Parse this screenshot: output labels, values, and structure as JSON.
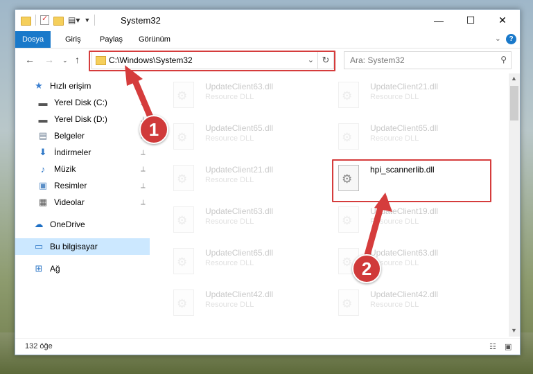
{
  "window": {
    "title": "System32"
  },
  "ribbon": {
    "tabs": [
      "Dosya",
      "Giriş",
      "Paylaş",
      "Görünüm"
    ],
    "help": "?"
  },
  "nav": {
    "address": "C:\\Windows\\System32",
    "search_placeholder": "Ara: System32"
  },
  "sidebar": {
    "items": [
      {
        "label": "Hızlı erişim",
        "icon": "star-icon",
        "pinned": false
      },
      {
        "label": "Yerel Disk (C:)",
        "icon": "drive-icon",
        "pinned": true
      },
      {
        "label": "Yerel Disk (D:)",
        "icon": "drive-icon",
        "pinned": true
      },
      {
        "label": "Belgeler",
        "icon": "documents-icon",
        "pinned": true
      },
      {
        "label": "İndirmeler",
        "icon": "download-icon",
        "pinned": true
      },
      {
        "label": "Müzik",
        "icon": "music-icon",
        "pinned": true
      },
      {
        "label": "Resimler",
        "icon": "pictures-icon",
        "pinned": true
      },
      {
        "label": "Videolar",
        "icon": "videos-icon",
        "pinned": true
      },
      {
        "label": "OneDrive",
        "icon": "cloud-icon",
        "pinned": false
      },
      {
        "label": "Bu bilgisayar",
        "icon": "computer-icon",
        "pinned": false
      },
      {
        "label": "Ağ",
        "icon": "network-icon",
        "pinned": false
      }
    ]
  },
  "files": [
    {
      "name": "UpdateClient63.dll",
      "type": "Resource DLL",
      "faded": true
    },
    {
      "name": "UpdateClient21.dll",
      "type": "Resource DLL",
      "faded": true
    },
    {
      "name": "UpdateClient65.dll",
      "type": "Resource DLL",
      "faded": true
    },
    {
      "name": "UpdateClient65.dll",
      "type": "Resource DLL",
      "faded": true
    },
    {
      "name": "UpdateClient21.dll",
      "type": "Resource DLL",
      "faded": true
    },
    {
      "name": "hpi_scannerlib.dll",
      "type": "",
      "faded": false
    },
    {
      "name": "UpdateClient63.dll",
      "type": "Resource DLL",
      "faded": true
    },
    {
      "name": "UpdateClient19.dll",
      "type": "Resource DLL",
      "faded": true
    },
    {
      "name": "UpdateClient65.dll",
      "type": "Resource DLL",
      "faded": true
    },
    {
      "name": "UpdateClient63.dll",
      "type": "Resource DLL",
      "faded": true
    },
    {
      "name": "UpdateClient42.dll",
      "type": "Resource DLL",
      "faded": true
    },
    {
      "name": "UpdateClient42.dll",
      "type": "Resource DLL",
      "faded": true
    }
  ],
  "status": {
    "count": "132 öğe"
  },
  "annotations": {
    "step1": "1",
    "step2": "2",
    "color": "#d53c3c"
  }
}
